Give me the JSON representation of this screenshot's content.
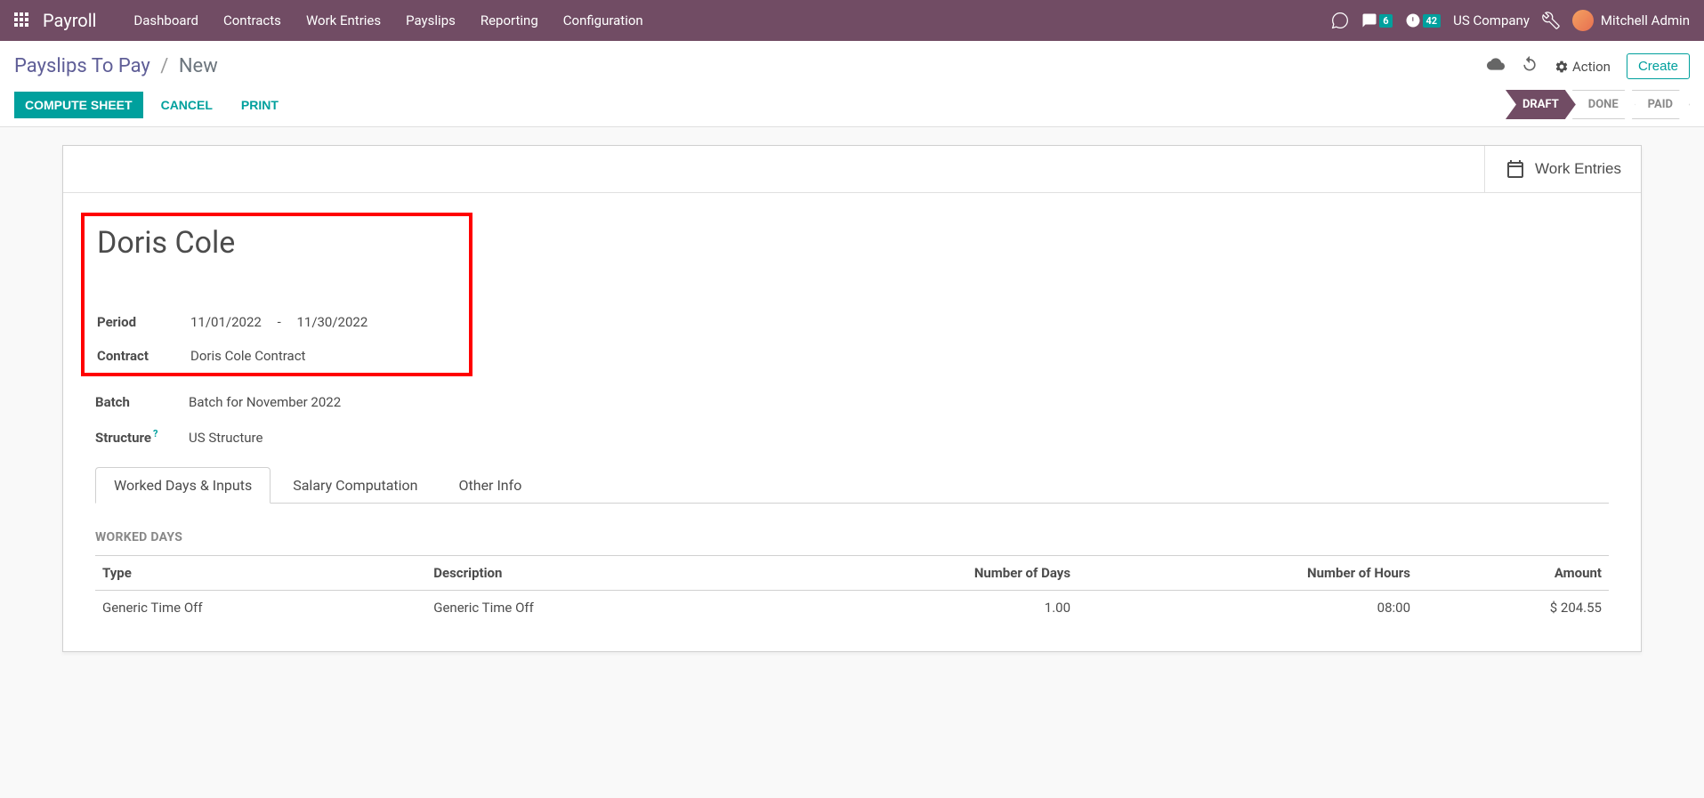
{
  "navbar": {
    "brand": "Payroll",
    "links": [
      "Dashboard",
      "Contracts",
      "Work Entries",
      "Payslips",
      "Reporting",
      "Configuration"
    ],
    "messages_badge": "6",
    "activities_badge": "42",
    "company": "US Company",
    "user_name": "Mitchell Admin"
  },
  "breadcrumb": {
    "parent": "Payslips To Pay",
    "current": "New"
  },
  "control_panel": {
    "action_label": "Action",
    "create_label": "Create",
    "compute_sheet": "COMPUTE SHEET",
    "cancel": "CANCEL",
    "print": "PRINT",
    "status": {
      "draft": "DRAFT",
      "done": "DONE",
      "paid": "PAID"
    }
  },
  "stat_button": {
    "work_entries": "Work Entries"
  },
  "form": {
    "employee_name": "Doris Cole",
    "period_label": "Period",
    "period_from": "11/01/2022",
    "period_sep": "-",
    "period_to": "11/30/2022",
    "contract_label": "Contract",
    "contract_value": "Doris Cole Contract",
    "batch_label": "Batch",
    "batch_value": "Batch for November 2022",
    "structure_label": "Structure",
    "structure_value": "US Structure"
  },
  "tabs": {
    "worked_days": "Worked Days & Inputs",
    "salary_computation": "Salary Computation",
    "other_info": "Other Info"
  },
  "worked_days_section": {
    "title": "WORKED DAYS",
    "headers": {
      "type": "Type",
      "description": "Description",
      "num_days": "Number of Days",
      "num_hours": "Number of Hours",
      "amount": "Amount"
    },
    "rows": [
      {
        "type": "Generic Time Off",
        "description": "Generic Time Off",
        "days": "1.00",
        "hours": "08:00",
        "amount": "$ 204.55"
      }
    ]
  }
}
